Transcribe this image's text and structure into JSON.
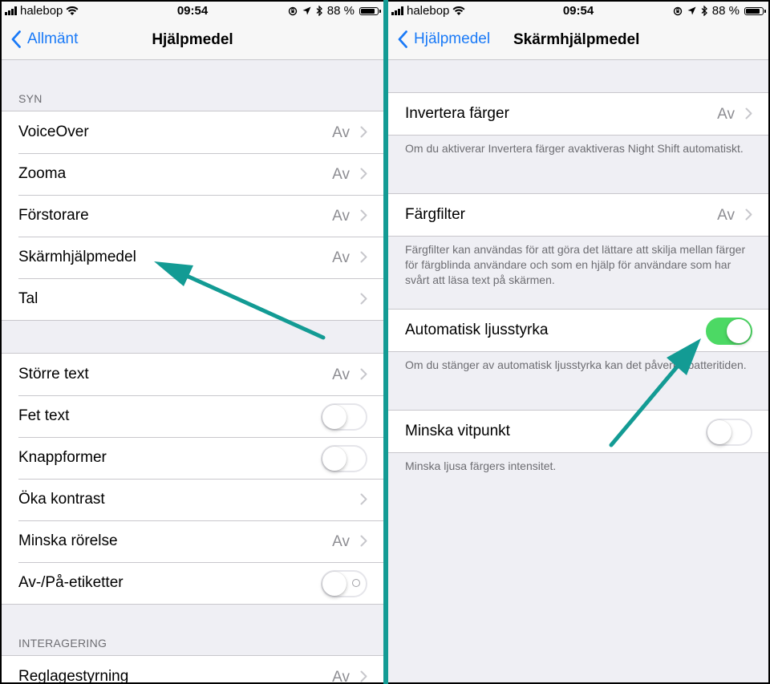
{
  "status_bar": {
    "carrier": "halebop",
    "time": "09:54",
    "battery": "88 %",
    "battery_level": 0.88,
    "icons": [
      "signal-icon",
      "wifi-icon",
      "orientation-lock-icon",
      "location-icon",
      "bluetooth-icon",
      "battery-icon"
    ]
  },
  "left": {
    "nav": {
      "back_label": "Allmänt",
      "title": "Hjälpmedel"
    },
    "sections": [
      {
        "header": "SYN",
        "rows": [
          {
            "label": "VoiceOver",
            "value": "Av"
          },
          {
            "label": "Zooma",
            "value": "Av"
          },
          {
            "label": "Förstorare",
            "value": "Av"
          },
          {
            "label": "Skärmhjälpmedel",
            "value": "Av"
          },
          {
            "label": "Tal",
            "value": ""
          }
        ]
      },
      {
        "header": "",
        "rows": [
          {
            "label": "Större text",
            "value": "Av"
          },
          {
            "label": "Fet text",
            "toggle": false
          },
          {
            "label": "Knappformer",
            "toggle": false
          },
          {
            "label": "Öka kontrast",
            "value": ""
          },
          {
            "label": "Minska rörelse",
            "value": "Av"
          },
          {
            "label": "Av-/På-etiketter",
            "toggle": false
          }
        ]
      },
      {
        "header": "INTERAGERING",
        "rows": [
          {
            "label": "Reglagestyrning",
            "value": "Av"
          }
        ]
      }
    ]
  },
  "right": {
    "nav": {
      "back_label": "Hjälpmedel",
      "title": "Skärmhjälpmedel"
    },
    "groups": [
      {
        "label": "Invertera färger",
        "value": "Av",
        "footer": "Om du aktiverar Invertera färger avaktiveras Night Shift automatiskt."
      },
      {
        "label": "Färgfilter",
        "value": "Av",
        "footer": "Färgfilter kan användas för att göra det lättare att skilja mellan färger för färgblinda användare och som en hjälp för användare som har svårt att läsa text på skärmen."
      },
      {
        "label": "Automatisk ljusstyrka",
        "toggle": true,
        "footer": "Om du stänger av automatisk ljusstyrka kan det påverka batteritiden."
      },
      {
        "label": "Minska vitpunkt",
        "toggle": false,
        "footer": "Minska ljusa färgers intensitet."
      }
    ]
  },
  "colors": {
    "accent": "#1a7af7",
    "toggle_on": "#4cd964",
    "annotation": "#139b94",
    "background": "#efeff4"
  }
}
